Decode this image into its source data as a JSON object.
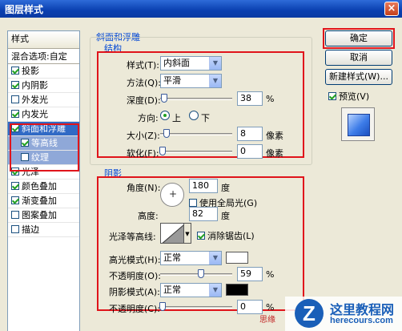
{
  "window": {
    "title": "图层样式",
    "close": "×"
  },
  "style_list": {
    "header": "样式",
    "blend_options": "混合选项:自定",
    "items": [
      {
        "label": "投影",
        "checked": true
      },
      {
        "label": "内阴影",
        "checked": true
      },
      {
        "label": "外发光",
        "checked": false
      },
      {
        "label": "内发光",
        "checked": true
      },
      {
        "label": "斜面和浮雕",
        "checked": true
      },
      {
        "label": "等高线",
        "checked": true
      },
      {
        "label": "纹理",
        "checked": false
      },
      {
        "label": "光泽",
        "checked": true
      },
      {
        "label": "颜色叠加",
        "checked": true
      },
      {
        "label": "渐变叠加",
        "checked": true
      },
      {
        "label": "图案叠加",
        "checked": false
      },
      {
        "label": "描边",
        "checked": false
      }
    ]
  },
  "bevel": {
    "section_title": "斜面和浮雕",
    "structure_title": "结构",
    "style_label": "样式(T):",
    "style_value": "内斜面",
    "technique_label": "方法(Q):",
    "technique_value": "平滑",
    "depth_label": "深度(D):",
    "depth_value": "38",
    "depth_unit": "%",
    "direction_label": "方向:",
    "dir_up": "上",
    "dir_down": "下",
    "size_label": "大小(Z):",
    "size_value": "8",
    "size_unit": "像素",
    "soften_label": "软化(F):",
    "soften_value": "0",
    "soften_unit": "像素"
  },
  "shading": {
    "title": "阴影",
    "angle_label": "角度(N):",
    "angle_value": "180",
    "angle_unit": "度",
    "global_light": "使用全局光(G)",
    "altitude_label": "高度:",
    "altitude_value": "82",
    "altitude_unit": "度",
    "gloss_label": "光泽等高线:",
    "antialias": "消除锯齿(L)",
    "highlight_label": "高光模式(H):",
    "highlight_mode": "正常",
    "highlight_opacity_label": "不透明度(O):",
    "highlight_opacity": "59",
    "highlight_opacity_unit": "%",
    "shadow_label": "阴影模式(A):",
    "shadow_mode": "正常",
    "shadow_opacity_label": "不透明度(C):",
    "shadow_opacity": "0",
    "shadow_opacity_unit": "%",
    "highlight_color": "#ffffff",
    "shadow_color": "#000000"
  },
  "buttons": {
    "ok": "确定",
    "cancel": "取消",
    "new_style": "新建样式(W)...",
    "preview": "预览(V)"
  },
  "watermark": {
    "cn": "这里教程网",
    "en": "herecours.com",
    "logo": "Z",
    "signature": "思缘"
  }
}
